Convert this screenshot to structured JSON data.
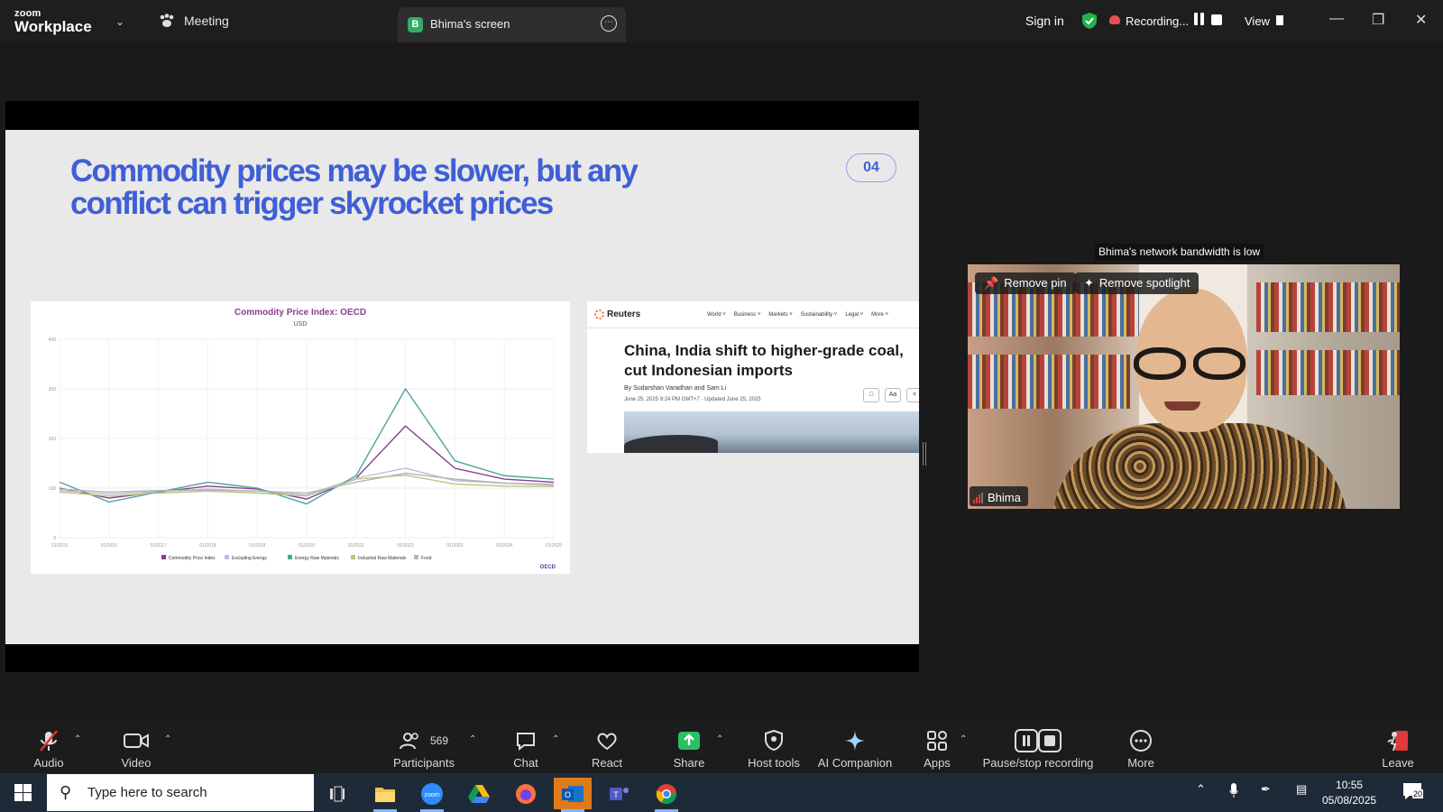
{
  "topbar": {
    "logo_line1": "zoom",
    "logo_line2": "Workplace",
    "meeting_tab": "Meeting",
    "screen_tab_badge": "B",
    "screen_tab": "Bhima's screen",
    "signin": "Sign in",
    "recording": "Recording...",
    "view": "View"
  },
  "slide": {
    "title": "Commodity prices may be slower, but any conflict can trigger skyrocket prices",
    "number": "04"
  },
  "chart_data": {
    "type": "line",
    "title": "Commodity Price Index: OECD",
    "subtitle": "USD",
    "ylim": [
      0,
      400
    ],
    "yticks": [
      "0",
      "100",
      "200",
      "300",
      "400"
    ],
    "x": [
      "01/2015",
      "01/2016",
      "01/2017",
      "01/2018",
      "01/2019",
      "01/2020",
      "01/2021",
      "01/2022",
      "01/2023",
      "01/2024",
      "01/2025"
    ],
    "series": [
      {
        "name": "Commodity Price Index",
        "color": "#8b3f8f",
        "values": [
          100,
          80,
          92,
          104,
          98,
          78,
          120,
          225,
          140,
          118,
          112
        ]
      },
      {
        "name": "Excluding Energy",
        "color": "#c9b7de",
        "values": [
          95,
          88,
          93,
          98,
          94,
          86,
          120,
          140,
          115,
          110,
          108
        ]
      },
      {
        "name": "Energy Raw Materials",
        "color": "#4fa59e",
        "values": [
          112,
          72,
          92,
          112,
          100,
          68,
          125,
          300,
          155,
          125,
          118
        ]
      },
      {
        "name": "Industrial Raw Materials",
        "color": "#b7c97e",
        "values": [
          92,
          84,
          90,
          94,
          90,
          84,
          118,
          126,
          108,
          104,
          103
        ]
      },
      {
        "name": "Food",
        "color": "#b5b5b5",
        "values": [
          98,
          92,
          95,
          96,
          94,
          90,
          112,
          130,
          118,
          110,
          106
        ]
      }
    ],
    "legend": "bottom",
    "watermark": "OECD"
  },
  "news": {
    "brand": "Reuters",
    "nav": [
      "World ˅",
      "Business ˅",
      "Markets ˅",
      "Sustainability ˅",
      "Legal ˅",
      "More ˅"
    ],
    "headline": "China, India shift to higher-grade coal, cut Indonesian imports",
    "byline": "By Sudarshan Varadhan and Sam Li",
    "dateline": "June 25, 2025 9:24 PM GMT+7 · Updated June 25, 2025",
    "aa": "Aa"
  },
  "video": {
    "bandwidth_note": "Bhima's network bandwidth is low",
    "remove_pin": "Remove pin",
    "remove_spotlight": "Remove spotlight",
    "participant_name": "Bhima"
  },
  "toolbar": {
    "audio": "Audio",
    "video": "Video",
    "participants": "Participants",
    "participant_count": "569",
    "chat": "Chat",
    "react": "React",
    "share": "Share",
    "host_tools": "Host tools",
    "ai_companion": "AI Companion",
    "apps": "Apps",
    "pause_stop": "Pause/stop recording",
    "more": "More",
    "leave": "Leave"
  },
  "taskbar": {
    "search_placeholder": "Type here to search",
    "time": "10:55",
    "date": "05/08/2025",
    "notifications": "20"
  },
  "colors": {
    "slide_title": "#3f5fd6",
    "share_green": "#2bbf63",
    "record_red": "#e85050"
  }
}
